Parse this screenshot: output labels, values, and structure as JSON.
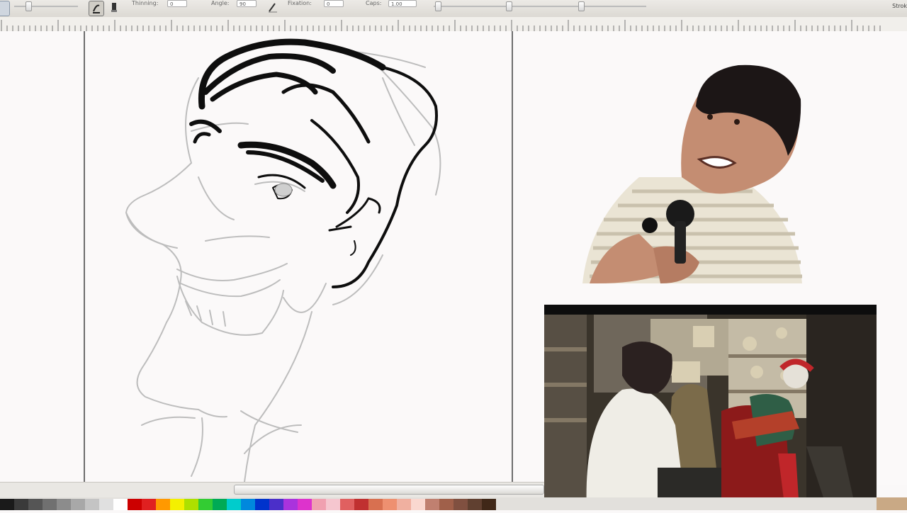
{
  "toolbar": {
    "thinning_label": "Thinning:",
    "thinning_value": "0",
    "angle_label": "Angle:",
    "angle_value": "90",
    "fixation_label": "Fixation:",
    "fixation_value": "0",
    "caps_label": "Caps:",
    "caps_value": "1.00",
    "dock_label": "Strok"
  },
  "palette": {
    "colors": [
      "#1a1a1a",
      "#3a3a3a",
      "#555555",
      "#707070",
      "#8c8c8c",
      "#a8a8a8",
      "#c4c4c4",
      "#e0e0e0",
      "#ffffff",
      "#cc0000",
      "#e02020",
      "#ff9900",
      "#f4f000",
      "#aee000",
      "#33cc33",
      "#00aa55",
      "#00cccc",
      "#0088dd",
      "#0033cc",
      "#4b2fc9",
      "#aa33dd",
      "#dd33cc",
      "#f0a0b0",
      "#f5c6cf",
      "#e06060",
      "#c03030",
      "#d87050",
      "#ee9070",
      "#f0b0a0",
      "#fad8d0",
      "#c08070",
      "#a0604a",
      "#805040",
      "#604030",
      "#402818"
    ]
  },
  "icons": {
    "brush": "brush-tool-icon",
    "pen": "pressure-pen-icon",
    "tremor": "tremor-icon"
  }
}
